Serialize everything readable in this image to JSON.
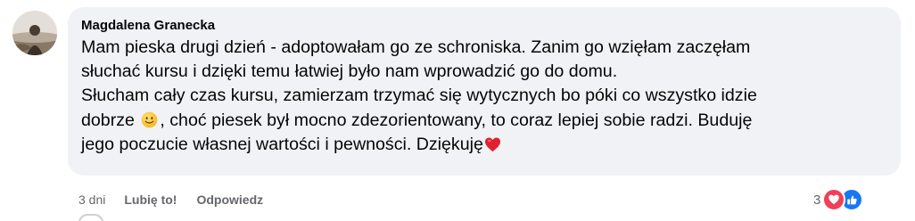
{
  "comment": {
    "author": "Magdalena Granecka",
    "lines": [
      "Mam pieska drugi dzień - adoptowałam go ze schroniska. Zanim go wzięłam zaczęłam",
      "słuchać kursu i dzięki temu łatwiej było nam wprowadzić go do domu.",
      "Słucham cały czas kursu, zamierzam trzymać się wytycznych bo póki co wszystko idzie"
    ],
    "line4_before_emoji": "dobrze ",
    "line4_after_emoji": ", choć piesek był mocno zdezorientowany, to coraz lepiej sobie radzi. Buduję",
    "line5": "jego poczucie własnej wartości i pewności. Dziękuję",
    "emojis": [
      "slightly-smiling-face",
      "red-heart"
    ]
  },
  "actions": {
    "time": "3 dni",
    "like_label": "Lubię to!",
    "reply_label": "Odpowiedz"
  },
  "reactions": {
    "count": "3",
    "icons": [
      "love-reaction-icon",
      "like-reaction-icon"
    ]
  },
  "colors": {
    "bubble_bg": "#f0f2f5",
    "text": "#050505",
    "secondary_text": "#65676b",
    "love_red": "#f33e58",
    "like_blue": "#1877f2"
  }
}
